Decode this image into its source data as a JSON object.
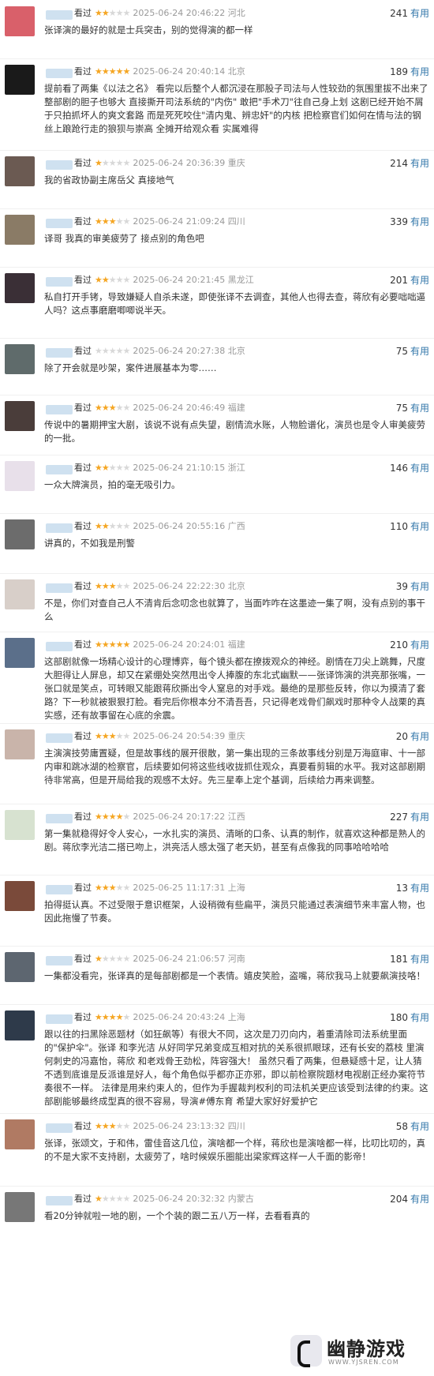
{
  "reviews": [
    {
      "action": "看过",
      "rating": 2,
      "time": "2025-06-24 20:46:22",
      "location": "河北",
      "votes": "241",
      "useful_label": "有用",
      "text": "张译演的最好的就是士兵突击，别的觉得演的都一样",
      "avatar_color": "#d9606a"
    },
    {
      "action": "看过",
      "rating": 5,
      "time": "2025-06-24 20:40:14",
      "location": "北京",
      "votes": "189",
      "useful_label": "有用",
      "text": "提前看了两集《以法之名》 看完以后整个人都沉浸在那股子司法与人性较劲的氛围里拔不出来了 整部剧的胆子也够大 直接撕开司法系统的\"内伤\" 敢把\"手术刀\"往自己身上划 这剧已经开始不屑于只拍抓坏人的爽文套路 而是死死咬住\"清内鬼、辨忠奸\"的内核 把检察官们如何在情与法的钢丝上踉跄行走的狼狈与崇高 全摊开给观众看 实属难得",
      "avatar_color": "#1a1a1a"
    },
    {
      "action": "看过",
      "rating": 1,
      "time": "2025-06-24 20:36:39",
      "location": "重庆",
      "votes": "214",
      "useful_label": "有用",
      "text": "我的省政协副主席岳父 真接地气",
      "avatar_color": "#6b5a52"
    },
    {
      "action": "看过",
      "rating": 3,
      "time": "2025-06-24 21:09:24",
      "location": "四川",
      "votes": "339",
      "useful_label": "有用",
      "text": "译哥 我真的审美疲劳了 接点别的角色吧",
      "avatar_color": "#8a7b66"
    },
    {
      "action": "看过",
      "rating": 2,
      "time": "2025-06-24 20:21:45",
      "location": "黑龙江",
      "votes": "201",
      "useful_label": "有用",
      "text": "私自打开手铐，导致嫌疑人自杀未遂，即使张译不去调查，其他人也得去查，蒋欣有必要咄咄逼人吗？这点事磨磨唧唧说半天。",
      "avatar_color": "#3a2f36"
    },
    {
      "action": "看过",
      "rating": 0,
      "time": "2025-06-24 20:27:38",
      "location": "北京",
      "votes": "75",
      "useful_label": "有用",
      "text": "除了开会就是吵架，案件进展基本为零……",
      "avatar_color": "#5f6b6b"
    },
    {
      "action": "看过",
      "rating": 3,
      "time": "2025-06-24 20:46:49",
      "location": "福建",
      "votes": "75",
      "useful_label": "有用",
      "text": "传说中的暑期押宝大剧，该说不说有点失望，剧情流水账，人物脸谱化，演员也是令人审美疲劳的一批。",
      "avatar_color": "#4a3d3a"
    },
    {
      "action": "看过",
      "rating": 2,
      "time": "2025-06-24 21:10:15",
      "location": "浙江",
      "votes": "146",
      "useful_label": "有用",
      "text": "一众大牌演员，拍的毫无吸引力。",
      "avatar_color": "#e8e0ea"
    },
    {
      "action": "看过",
      "rating": 2,
      "time": "2025-06-24 20:55:16",
      "location": "广西",
      "votes": "110",
      "useful_label": "有用",
      "text": "讲真的，不如我是刑警",
      "avatar_color": "#6c6c6c"
    },
    {
      "action": "看过",
      "rating": 3,
      "time": "2025-06-24 22:22:30",
      "location": "北京",
      "votes": "39",
      "useful_label": "有用",
      "text": "不是，你们对查自己人不清肯后念叨念也就算了，当面咋咋在这墨迹一集了啊，没有点别的事干么",
      "avatar_color": "#d8cfc9"
    },
    {
      "action": "看过",
      "rating": 5,
      "time": "2025-06-24 20:24:01",
      "location": "福建",
      "votes": "210",
      "useful_label": "有用",
      "text": "这部剧就像一场精心设计的心理博弈，每个镜头都在撩拨观众的神经。剧情在刀尖上跳舞，尺度大胆得让人屏息，却又在紧绷处突然甩出令人捧腹的东北式幽默——张译饰演的洪亮那张嘴，一张口就是笑点，可转眼又能跟蒋欣撕出令人窒息的对手戏。最绝的是那些反转，你以为摸清了套路？下一秒就被狠狠打脸。看完后你根本分不清吾吾，只记得老戏骨们飙戏时那种令人战栗的真实感，还有故事留在心底的余震。",
      "avatar_color": "#5b6f8a"
    },
    {
      "action": "看过",
      "rating": 3,
      "time": "2025-06-24 20:54:39",
      "location": "重庆",
      "votes": "20",
      "useful_label": "有用",
      "text": "主演演技劳庸置疑，但是故事线的展开很散，第一集出现的三条故事线分别是万海庭审、十一部内审和跳冰湖的检察官，后续要如何将这些线收拢抓住观众，真要看剪辑的水平。我对这部剧期待非常高，但是开局给我的观感不太好。先三星奉上定个基调，后续给力再来调整。",
      "avatar_color": "#c9b4aa"
    },
    {
      "action": "看过",
      "rating": 4,
      "time": "2025-06-24 20:17:22",
      "location": "江西",
      "votes": "227",
      "useful_label": "有用",
      "text": "第一集就稳得好令人安心，一水扎实的演员、清晰的口条、认真的制作，就喜欢这种都是熟人的剧。蒋欣李光洁二搭已吻上，洪亮活人感太强了老天奶，甚至有点像我的同事哈哈哈哈",
      "avatar_color": "#d7e2d0"
    },
    {
      "action": "看过",
      "rating": 3,
      "time": "2025-06-25 11:17:31",
      "location": "上海",
      "votes": "13",
      "useful_label": "有用",
      "text": "拍得挺认真。不过受限于意识框架，人设稍微有些扁平，演员只能通过表演细节来丰富人物，也因此拖慢了节奏。",
      "avatar_color": "#7a4a3a"
    },
    {
      "action": "看过",
      "rating": 1,
      "time": "2025-06-24 21:06:57",
      "location": "河南",
      "votes": "181",
      "useful_label": "有用",
      "text": "一集都没看完，张译真的是每部剧都是一个表情。嬉皮笑脸，盗嘴，蒋欣我马上就要飙演技咯！",
      "avatar_color": "#5d6670"
    },
    {
      "action": "看过",
      "rating": 4,
      "time": "2025-06-24 20:43:24",
      "location": "上海",
      "votes": "180",
      "useful_label": "有用",
      "text": "跟以往的扫黑除恶题材（如狂飙等）有很大不同，这次是刀刃向内，着重清除司法系统里面的\"保护伞\"。张译 和李光洁 从好同学兄弟变成互相对抗的关系很抓眼球，还有长安的荔枝 里演何刺史的冯嘉怡，蒋欣 和老戏骨王劲松，阵容强大！ 虽然只看了两集，但悬疑感十足，让人猜不透到底谁是反派谁是好人，每个角色似乎都亦正亦邪，即以前检察院题材电视剧正经办案符节奏很不一样。 法律是用来约束人的，但作为手握裁判权利的司法机关更应该受到法律的约束。这部剧能够最终成型真的很不容易，导演#傅东育 希望大家好好爱护它",
      "avatar_color": "#2e3a4a"
    },
    {
      "action": "看过",
      "rating": 3,
      "time": "2025-06-24 23:13:32",
      "location": "四川",
      "votes": "58",
      "useful_label": "有用",
      "text": "张译，张颂文，于和伟，雷佳音这几位，演啥都一个样，蒋欣也是演啥都一样，比叨比叨的，真的不是大家不支持剧，太疲劳了，啥时候娱乐圈能出梁家辉这样一人千面的影帝！",
      "avatar_color": "#b07a63"
    },
    {
      "action": "看过",
      "rating": 1,
      "time": "2025-06-24 20:32:32",
      "location": "内蒙古",
      "votes": "204",
      "useful_label": "有用",
      "text": "看20分钟就啦一地的剧，一个个装的跟二五八万一样，去看看真的",
      "avatar_color": "#777777"
    }
  ],
  "watermark": {
    "title": "幽静游戏",
    "url": "WWW.YJSREN.COM"
  }
}
